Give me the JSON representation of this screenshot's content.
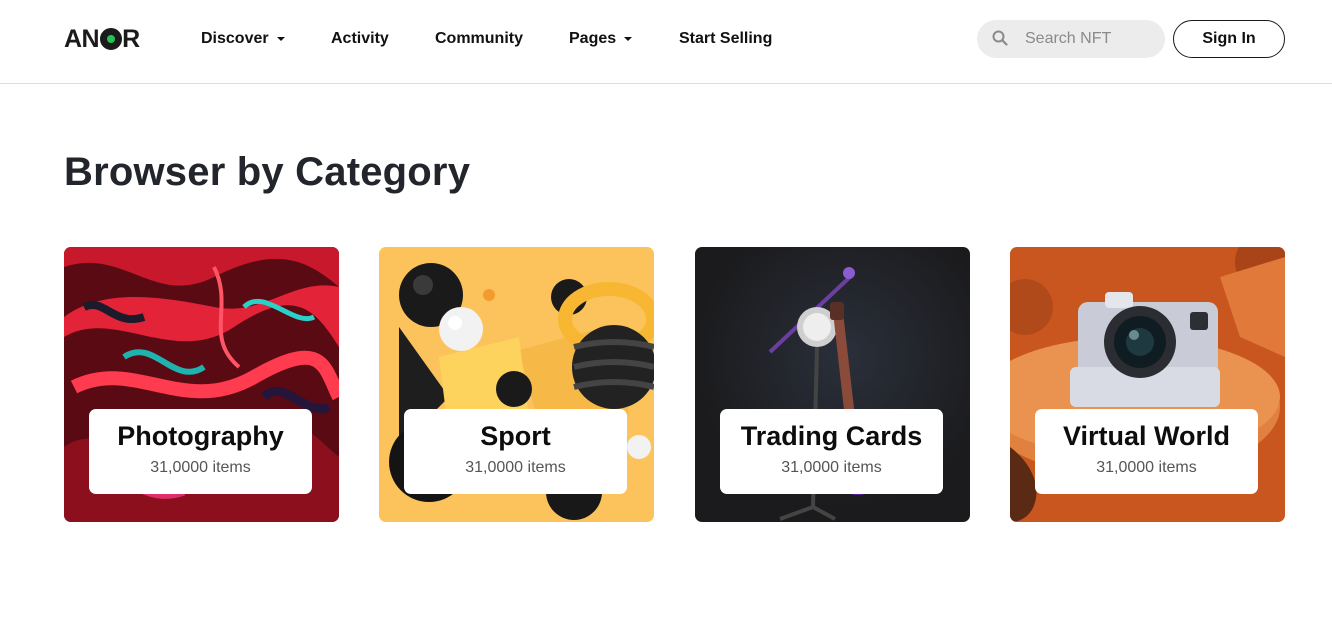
{
  "brand": {
    "logo_text_left": "AN",
    "logo_text_right": "R",
    "accent": "#25c254"
  },
  "nav": {
    "items": [
      {
        "label": "Discover",
        "dropdown": true
      },
      {
        "label": "Activity",
        "dropdown": false
      },
      {
        "label": "Community",
        "dropdown": false
      },
      {
        "label": "Pages",
        "dropdown": true
      },
      {
        "label": "Start Selling",
        "dropdown": false
      }
    ]
  },
  "search": {
    "placeholder": "Search NFT",
    "value": "",
    "icon": "search-icon"
  },
  "auth": {
    "signin_label": "Sign In"
  },
  "main": {
    "title": "Browser by Category",
    "categories": [
      {
        "name": "Photography",
        "count": "31,0000 items",
        "image": "abstract-red-teal-art"
      },
      {
        "name": "Sport",
        "count": "31,0000 items",
        "image": "3d-spheres-rings-yellow"
      },
      {
        "name": "Trading Cards",
        "count": "31,0000 items",
        "image": "guitar-microphone-dark"
      },
      {
        "name": "Virtual World",
        "count": "31,0000 items",
        "image": "instant-camera-orange"
      }
    ]
  }
}
